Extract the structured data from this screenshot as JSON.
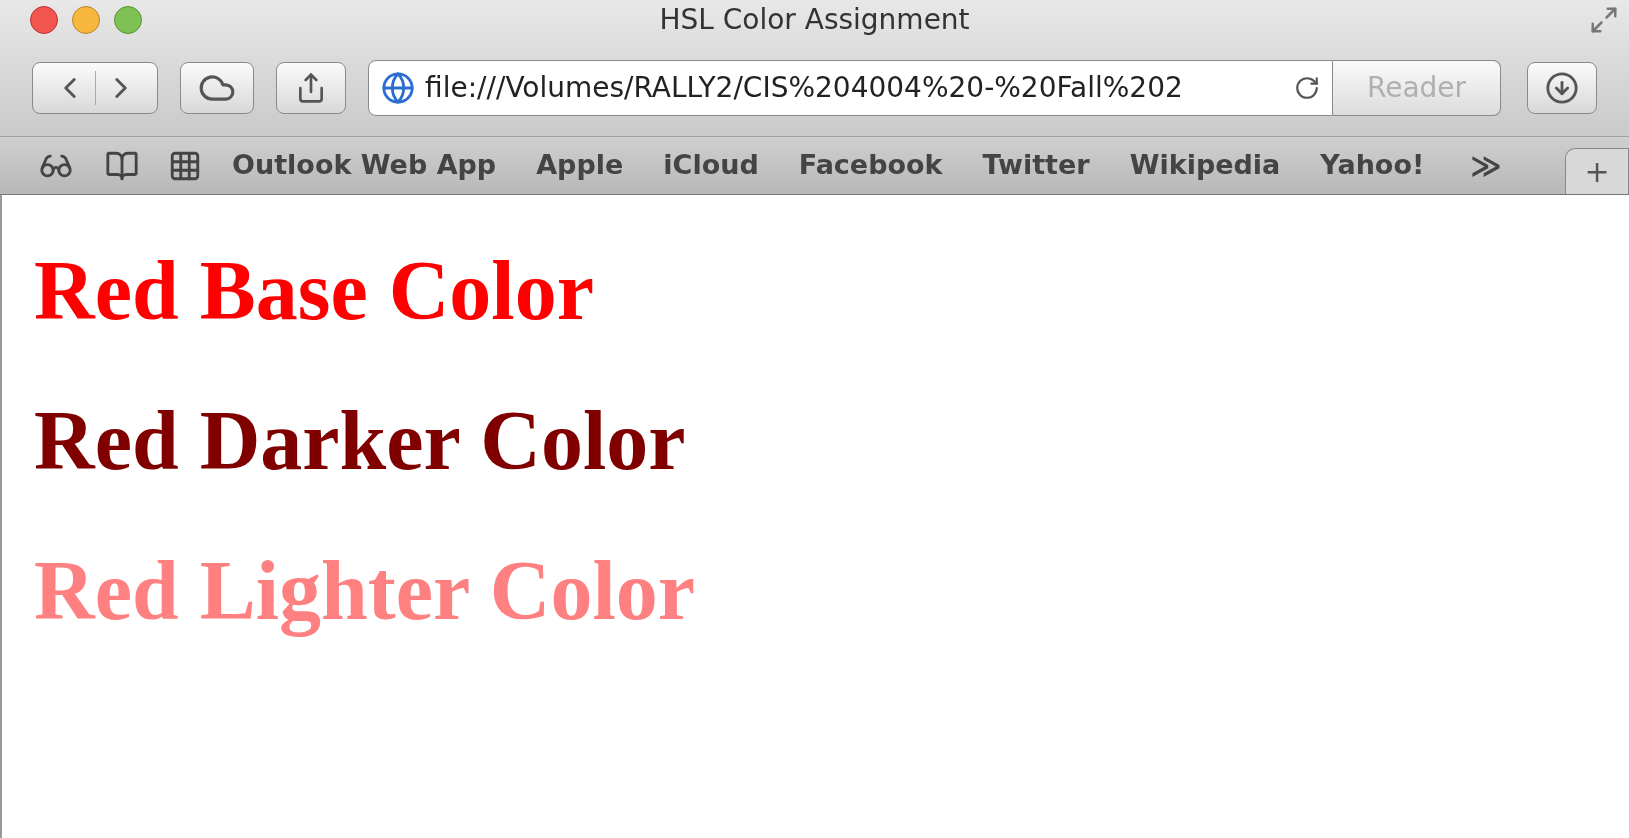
{
  "window": {
    "title": "HSL Color Assignment"
  },
  "address_bar": {
    "value": "file:///Volumes/RALLY2/CIS%204004%20-%20Fall%202"
  },
  "reader_button": {
    "label": "Reader",
    "disabled": true
  },
  "bookmarks": [
    "Outlook Web App",
    "Apple",
    "iCloud",
    "Facebook",
    "Twitter",
    "Wikipedia",
    "Yahoo!"
  ],
  "overflow": "≫",
  "new_tab": "+",
  "headings": [
    {
      "text": "Red Base Color",
      "color": "#ff0000"
    },
    {
      "text": "Red Darker Color",
      "color": "#800000"
    },
    {
      "text": "Red Lighter Color",
      "color": "#ff8080"
    }
  ]
}
